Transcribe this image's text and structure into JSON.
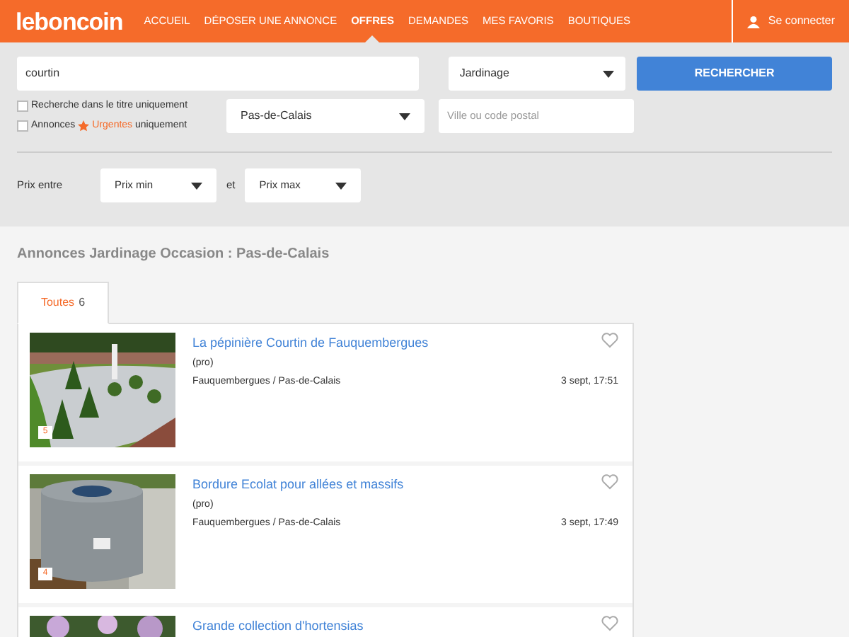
{
  "header": {
    "logo": "leboncoin",
    "nav": [
      {
        "label": "ACCUEIL",
        "selected": false
      },
      {
        "label": "DÉPOSER UNE ANNONCE",
        "selected": false
      },
      {
        "label": "OFFRES",
        "selected": true
      },
      {
        "label": "DEMANDES",
        "selected": false
      },
      {
        "label": "MES FAVORIS",
        "selected": false
      },
      {
        "label": "BOUTIQUES",
        "selected": false
      }
    ],
    "login": "Se connecter"
  },
  "search": {
    "query": "courtin",
    "category": "Jardinage",
    "button": "RECHERCHER",
    "options": [
      {
        "kind": "plain",
        "label": "Recherche dans le titre uniquement",
        "checked": false
      },
      {
        "kind": "urgent",
        "prefix": "Annonces",
        "label": "**Urgentes** uniquement",
        "checked": false
      }
    ],
    "region": "Pas-de-Calais",
    "city_placeholder": "Ville ou code postal",
    "price_label": "Prix entre",
    "price_min": "Prix min",
    "price_and": "et",
    "price_max": "Prix max"
  },
  "heading": "Annonces Jardinage Occasion : Pas-de-Calais",
  "tabs": [
    {
      "label": "Toutes",
      "count": "6",
      "selected": true
    }
  ],
  "listings": [
    {
      "title": "La pépinière Courtin de Fauquembergues",
      "seller": "(pro)",
      "location": "Fauquembergues / Pas-de-Calais",
      "date": "3 sept, 17:51",
      "photos": "5",
      "kind": "garden"
    },
    {
      "title": "Bordure Ecolat pour allées et massifs",
      "seller": "(pro)",
      "location": "Fauquembergues / Pas-de-Calais",
      "date": "3 sept, 17:49",
      "photos": "4",
      "kind": "roll"
    },
    {
      "title": "Grande collection d'hortensias",
      "kind": "flowers"
    }
  ]
}
